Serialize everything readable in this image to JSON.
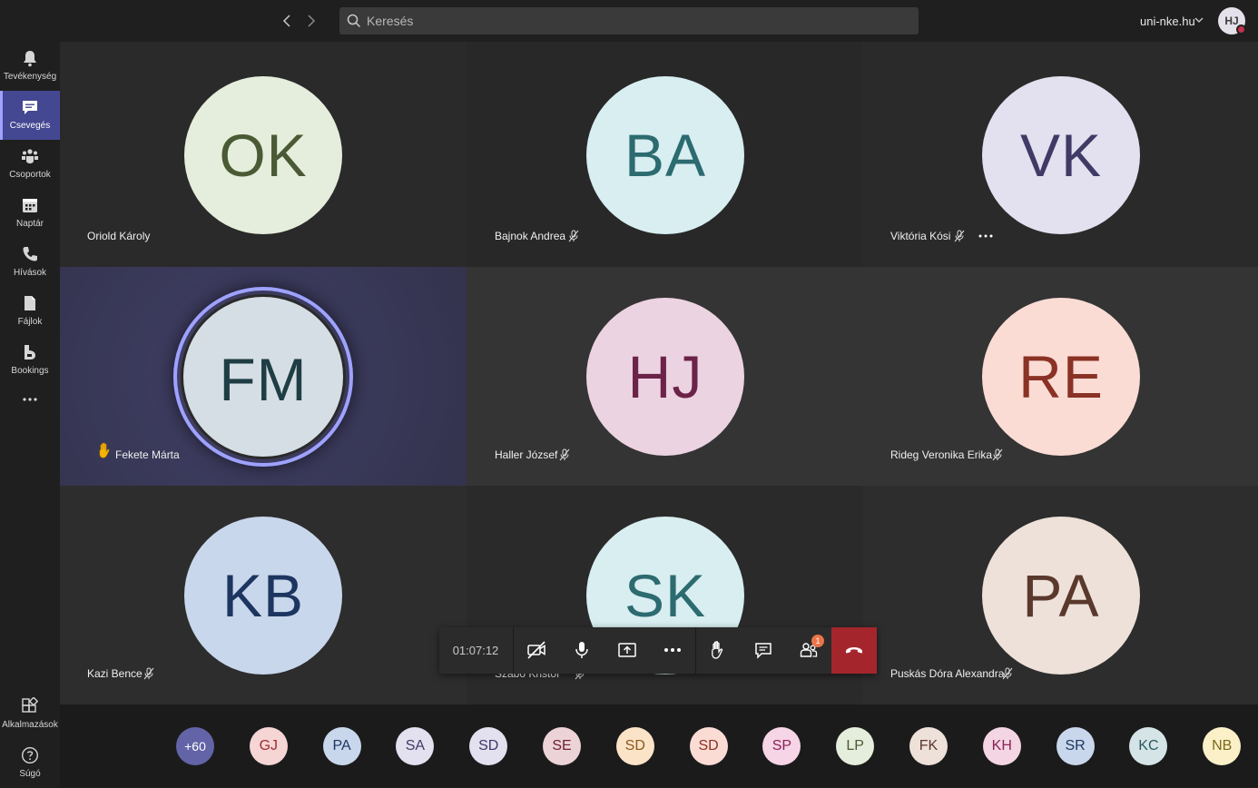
{
  "search": {
    "placeholder": "Keresés"
  },
  "account": {
    "tenant": "uni-nke.hu",
    "initials": "HJ"
  },
  "rail": [
    {
      "label": "Tevékenység",
      "icon": "bell-icon"
    },
    {
      "label": "Csevegés",
      "icon": "chat-icon",
      "active": true
    },
    {
      "label": "Csoportok",
      "icon": "teams-icon"
    },
    {
      "label": "Naptár",
      "icon": "calendar-icon"
    },
    {
      "label": "Hívások",
      "icon": "phone-icon"
    },
    {
      "label": "Fájlok",
      "icon": "file-icon"
    },
    {
      "label": "Bookings",
      "icon": "bookings-icon"
    }
  ],
  "rail_bottom": [
    {
      "label": "Alkalmazások",
      "icon": "apps-icon"
    },
    {
      "label": "Súgó",
      "icon": "help-icon"
    }
  ],
  "participants": [
    {
      "initials": "OK",
      "name": "Oriold Károly",
      "muted": false,
      "bg": "#e5eedc",
      "fg": "#4a5a34"
    },
    {
      "initials": "BA",
      "name": "Bajnok Andrea",
      "muted": true,
      "bg": "#d8eef1",
      "fg": "#2c6b70"
    },
    {
      "initials": "VK",
      "name": "Viktória Kósi",
      "muted": true,
      "more": true,
      "bg": "#e3e0ef",
      "fg": "#3f3b66"
    },
    {
      "initials": "FM",
      "name": "Fekete Márta",
      "hand_raised": true,
      "speaking": true,
      "bg": "#d5dee4",
      "fg": "#1f3d44"
    },
    {
      "initials": "HJ",
      "name": "Haller József",
      "muted": true,
      "bg": "#ecd3e2",
      "fg": "#6b2348"
    },
    {
      "initials": "RE",
      "name": "Rideg Veronika Erika",
      "muted": true,
      "bg": "#fbdcd5",
      "fg": "#8a3225"
    },
    {
      "initials": "KB",
      "name": "Kazi Bence",
      "muted": true,
      "bg": "#c9d7ec",
      "fg": "#1d3660"
    },
    {
      "initials": "SK",
      "name": "Szabó Kristóf",
      "muted": true,
      "bg": "#d8eef1",
      "fg": "#2c6b70"
    },
    {
      "initials": "PA",
      "name": "Puskás Dóra Alexandra",
      "muted": true,
      "bg": "#eee1d9",
      "fg": "#5a382c"
    }
  ],
  "controls": {
    "timer": "01:07:12",
    "participants_badge": "1"
  },
  "strip": [
    {
      "initials": "+60",
      "bg": "#6264a7",
      "fg": "#ffffff"
    },
    {
      "initials": "GJ",
      "bg": "#f6d5d5",
      "fg": "#9b2f2f"
    },
    {
      "initials": "PA",
      "bg": "#c9d7ec",
      "fg": "#1d3660"
    },
    {
      "initials": "SA",
      "bg": "#e3e0ef",
      "fg": "#3f3b66"
    },
    {
      "initials": "SD",
      "bg": "#e3e0ef",
      "fg": "#3f3b66"
    },
    {
      "initials": "SE",
      "bg": "#ecd3d8",
      "fg": "#6b2333"
    },
    {
      "initials": "SD",
      "bg": "#fbe3c8",
      "fg": "#8a5a1a"
    },
    {
      "initials": "SD",
      "bg": "#fbdcd5",
      "fg": "#8a3225"
    },
    {
      "initials": "SP",
      "bg": "#f6d5e6",
      "fg": "#8a2358"
    },
    {
      "initials": "LP",
      "bg": "#e5eedc",
      "fg": "#4a5a34"
    },
    {
      "initials": "FK",
      "bg": "#eee1d9",
      "fg": "#5a382c"
    },
    {
      "initials": "KH",
      "bg": "#f4d5e3",
      "fg": "#8a2358"
    },
    {
      "initials": "SR",
      "bg": "#c9d7ec",
      "fg": "#1d3660"
    },
    {
      "initials": "KC",
      "bg": "#d5e4e6",
      "fg": "#2c5a60"
    },
    {
      "initials": "NB",
      "bg": "#fbf0c8",
      "fg": "#7a6a1a"
    }
  ]
}
